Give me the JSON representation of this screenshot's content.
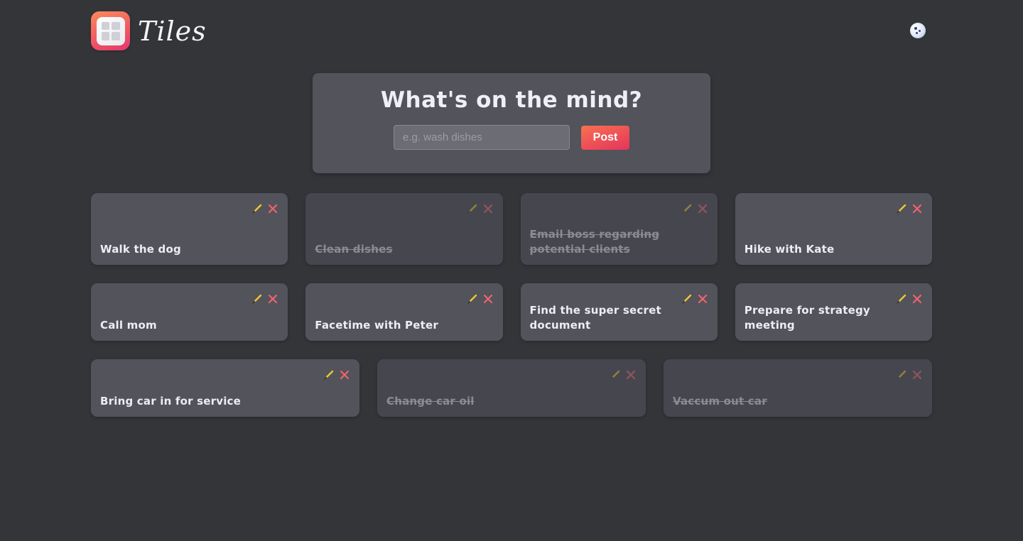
{
  "app": {
    "title": "Tiles"
  },
  "composer": {
    "heading": "What's on the mind?",
    "input_value": "",
    "input_placeholder": "e.g. wash dishes",
    "post_label": "Post"
  },
  "colors": {
    "background": "#343539",
    "tile": "#52535b",
    "tile_done": "#46474e",
    "accent_start": "#f7714f",
    "accent_end": "#e4345d",
    "edit_icon": "#f0c62f",
    "delete_icon": "#f0636d"
  },
  "icons": {
    "theme_toggle": "moon-icon",
    "edit": "pencil-icon",
    "delete": "close-icon"
  },
  "tiles": [
    {
      "text": "Walk the dog",
      "done": false
    },
    {
      "text": "Clean dishes",
      "done": true
    },
    {
      "text": "Email boss regarding potential clients",
      "done": true
    },
    {
      "text": "Hike with Kate",
      "done": false
    },
    {
      "text": "Call mom",
      "done": false
    },
    {
      "text": "Facetime with Peter",
      "done": false
    },
    {
      "text": "Find the super secret document",
      "done": false
    },
    {
      "text": "Prepare for strategy meeting",
      "done": false
    },
    {
      "text": "Bring car in for service",
      "done": false
    },
    {
      "text": "Change car oil",
      "done": true
    },
    {
      "text": "Vaccum out car",
      "done": true
    }
  ]
}
